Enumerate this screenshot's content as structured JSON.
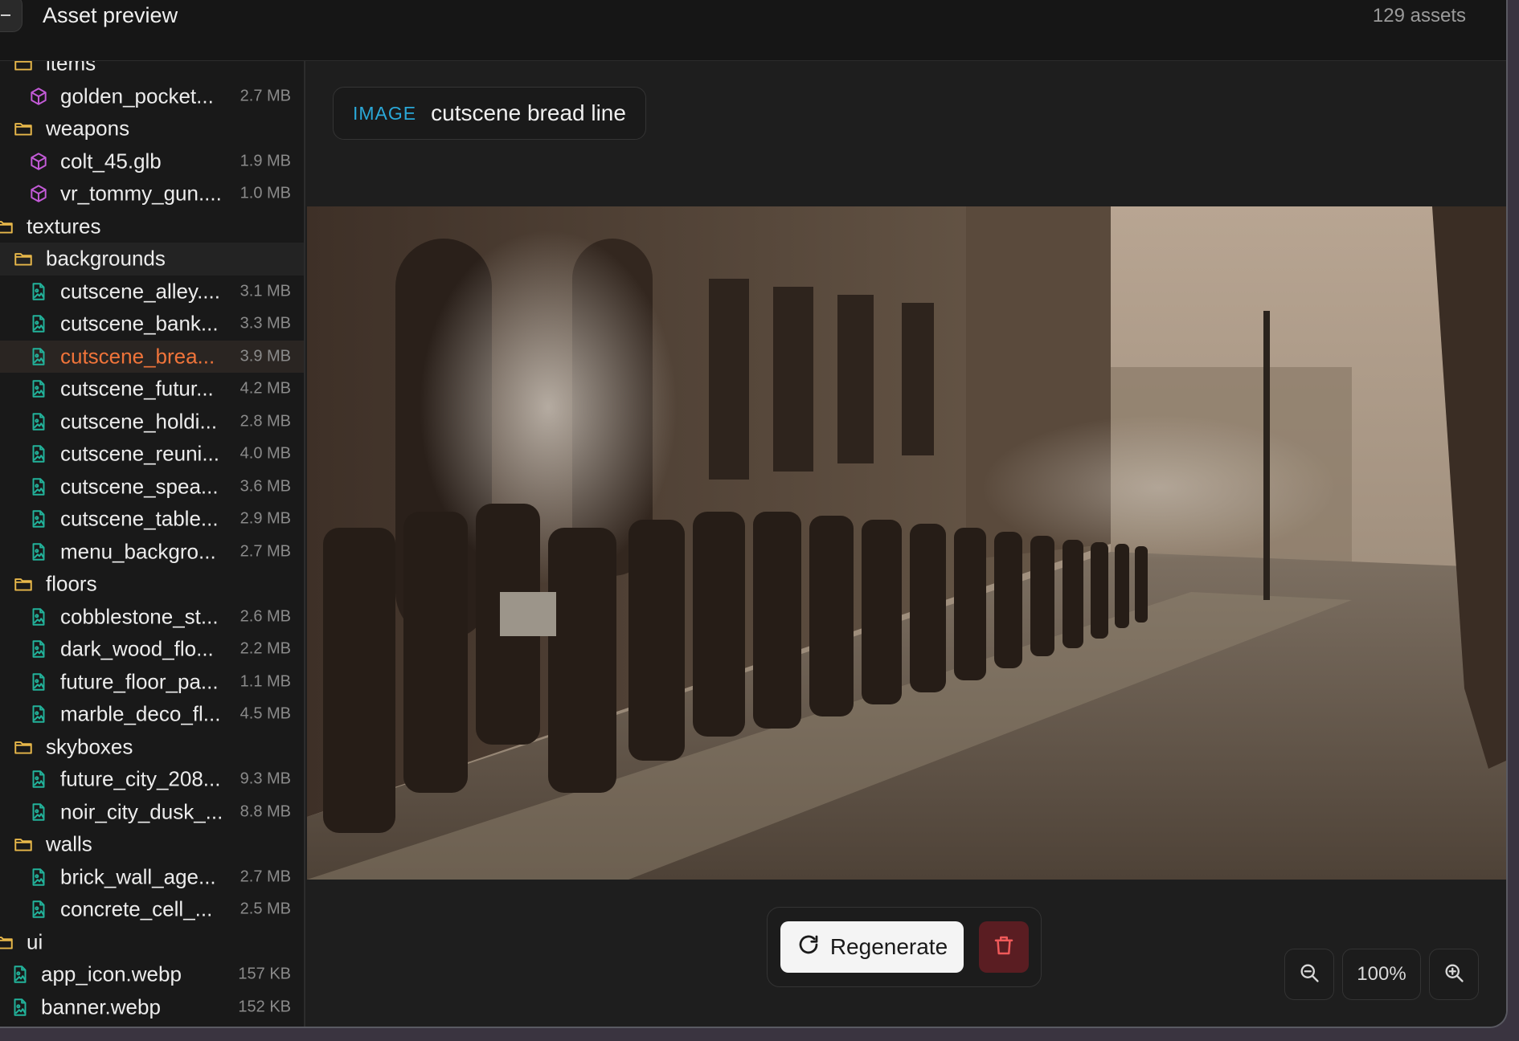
{
  "header": {
    "title": "Asset preview",
    "asset_count": "129 assets"
  },
  "tree": [
    {
      "kind": "folder",
      "level": "lvl1",
      "label": "items"
    },
    {
      "kind": "model",
      "level": "lvl2",
      "label": "golden_pocket...",
      "size": "2.7 MB"
    },
    {
      "kind": "folder",
      "level": "lvl1",
      "label": "weapons"
    },
    {
      "kind": "model",
      "level": "lvl2",
      "label": "colt_45.glb",
      "size": "1.9 MB"
    },
    {
      "kind": "model",
      "level": "lvl2",
      "label": "vr_tommy_gun....",
      "size": "1.0 MB"
    },
    {
      "kind": "folder",
      "level": "lvl0",
      "label": "textures"
    },
    {
      "kind": "folder",
      "level": "lvl1",
      "label": "backgrounds",
      "state": "hover"
    },
    {
      "kind": "image",
      "level": "lvl2",
      "label": "cutscene_alley....",
      "size": "3.1 MB"
    },
    {
      "kind": "image",
      "level": "lvl2",
      "label": "cutscene_bank...",
      "size": "3.3 MB"
    },
    {
      "kind": "image",
      "level": "lvl2",
      "label": "cutscene_brea...",
      "size": "3.9 MB",
      "state": "active"
    },
    {
      "kind": "image",
      "level": "lvl2",
      "label": "cutscene_futur...",
      "size": "4.2 MB"
    },
    {
      "kind": "image",
      "level": "lvl2",
      "label": "cutscene_holdi...",
      "size": "2.8 MB"
    },
    {
      "kind": "image",
      "level": "lvl2",
      "label": "cutscene_reuni...",
      "size": "4.0 MB"
    },
    {
      "kind": "image",
      "level": "lvl2",
      "label": "cutscene_spea...",
      "size": "3.6 MB"
    },
    {
      "kind": "image",
      "level": "lvl2",
      "label": "cutscene_table...",
      "size": "2.9 MB"
    },
    {
      "kind": "image",
      "level": "lvl2",
      "label": "menu_backgro...",
      "size": "2.7 MB"
    },
    {
      "kind": "folder",
      "level": "lvl1",
      "label": "floors"
    },
    {
      "kind": "image",
      "level": "lvl2",
      "label": "cobblestone_st...",
      "size": "2.6 MB"
    },
    {
      "kind": "image",
      "level": "lvl2",
      "label": "dark_wood_flo...",
      "size": "2.2 MB"
    },
    {
      "kind": "image",
      "level": "lvl2",
      "label": "future_floor_pa...",
      "size": "1.1 MB"
    },
    {
      "kind": "image",
      "level": "lvl2",
      "label": "marble_deco_fl...",
      "size": "4.5 MB"
    },
    {
      "kind": "folder",
      "level": "lvl1",
      "label": "skyboxes"
    },
    {
      "kind": "image",
      "level": "lvl2",
      "label": "future_city_208...",
      "size": "9.3 MB"
    },
    {
      "kind": "image",
      "level": "lvl2",
      "label": "noir_city_dusk_...",
      "size": "8.8 MB"
    },
    {
      "kind": "folder",
      "level": "lvl1",
      "label": "walls"
    },
    {
      "kind": "image",
      "level": "lvl2",
      "label": "brick_wall_age...",
      "size": "2.7 MB"
    },
    {
      "kind": "image",
      "level": "lvl2",
      "label": "concrete_cell_...",
      "size": "2.5 MB"
    },
    {
      "kind": "folder",
      "level": "lvl0",
      "label": "ui"
    },
    {
      "kind": "image",
      "level": "lvl1f",
      "label": "app_icon.webp",
      "size": "157 KB"
    },
    {
      "kind": "image",
      "level": "lvl1f",
      "label": "banner.webp",
      "size": "152 KB"
    }
  ],
  "asset": {
    "kind_label": "IMAGE",
    "name": "cutscene bread line"
  },
  "actions": {
    "regenerate_label": "Regenerate",
    "regenerate_icon": "refresh-icon",
    "delete_icon": "trash-icon"
  },
  "zoom": {
    "level": "100%",
    "out_icon": "zoom-out-icon",
    "in_icon": "zoom-in-icon"
  },
  "colors": {
    "folder": "#e8b84a",
    "model": "#c45bd8",
    "image": "#22b39b",
    "active": "#f0743a",
    "kind_label": "#2aa8d8",
    "delete_bg": "#5a1d22",
    "delete_icon": "#f05a5a"
  }
}
